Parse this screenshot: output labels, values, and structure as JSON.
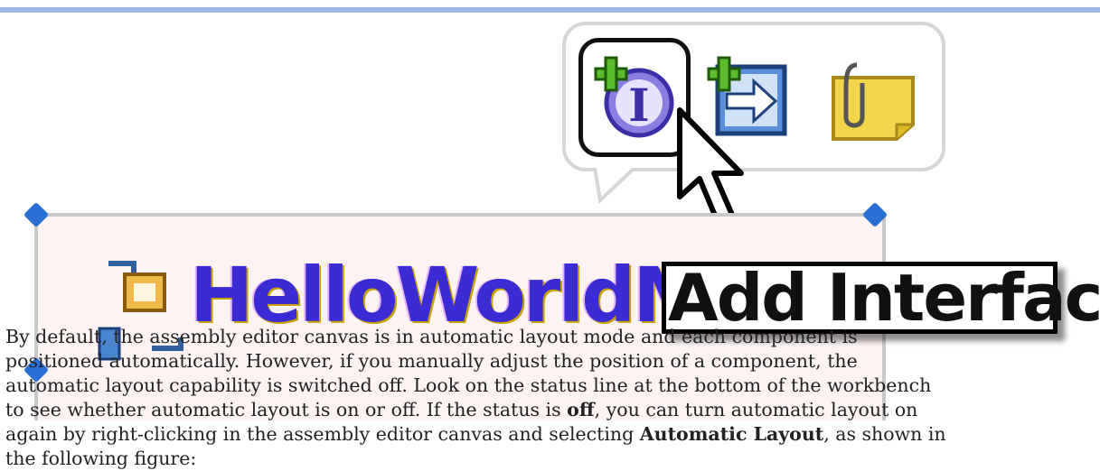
{
  "canvas": {
    "component_name": "HelloWorldMed",
    "hover_tooltip": "Add Interface"
  },
  "palette": {
    "tools": [
      {
        "name": "add-interface",
        "icon": "add-interface-icon"
      },
      {
        "name": "add-reference",
        "icon": "add-reference-icon"
      },
      {
        "name": "add-note",
        "icon": "note-icon"
      }
    ]
  },
  "paragraph": {
    "line1": "By default, the assembly editor canvas is in automatic layout mode and each component is",
    "line2": "positioned automatically. However, if you manually adjust the position of a component, the",
    "line3": "automatic layout capability is switched off. Look on the status line at the bottom of the workbench",
    "line4_pre": "to see whether automatic layout is on or off. If the status is ",
    "line4_bold": "off",
    "line4_post": ", you can turn automatic layout on",
    "line5_pre": "again by right-clicking in the assembly editor canvas and selecting ",
    "line5_bold": "Automatic Layout",
    "line5_post": ", as shown in",
    "line6": "the following figure:"
  },
  "colors": {
    "accent_bar": "#9bb8e6",
    "handle": "#2a6fd6",
    "component_bg": "#fdf3f3"
  }
}
